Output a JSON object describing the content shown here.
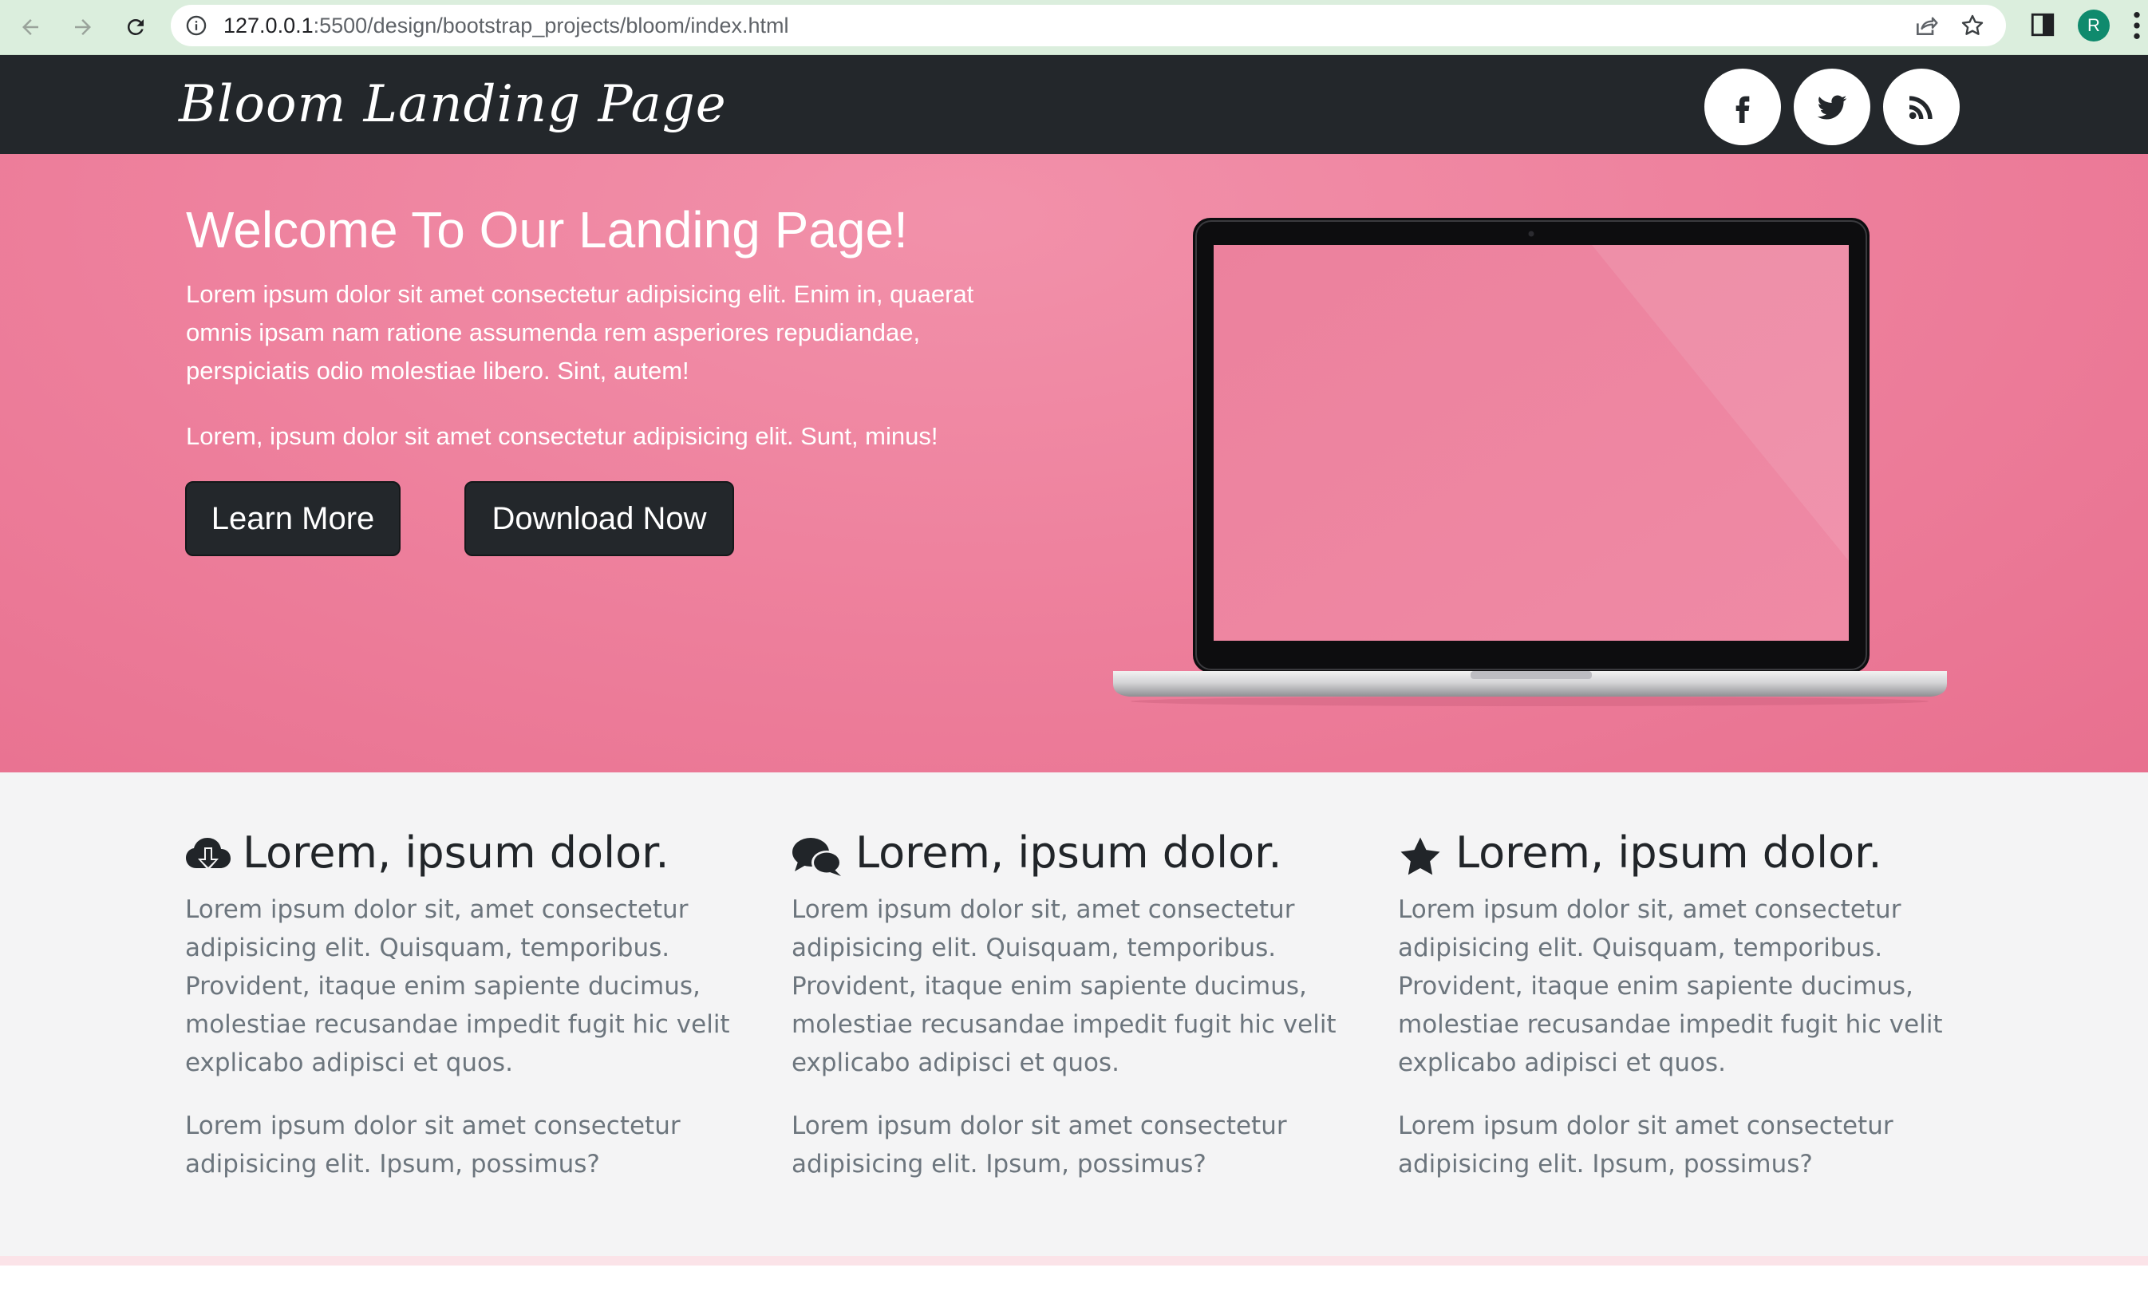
{
  "browser": {
    "url_host": "127.0.0.1",
    "url_rest": ":5500/design/bootstrap_projects/bloom/index.html",
    "profile_initial": "R",
    "icons": [
      "back-arrow-icon",
      "forward-arrow-icon",
      "reload-icon",
      "info-icon",
      "share-icon",
      "star-icon",
      "side-panel-icon",
      "more-menu-icon"
    ]
  },
  "navbar": {
    "brand": "Bloom Landing Page",
    "social": [
      "facebook-icon",
      "twitter-icon",
      "rss-icon"
    ]
  },
  "hero": {
    "title": "Welcome To Our Landing Page!",
    "paragraph1": "Lorem ipsum dolor sit amet consectetur adipisicing elit. Enim in, quaerat omnis ipsam nam ratione assumenda rem asperiores repudiandae, perspiciatis odio molestiae libero. Sint, autem!",
    "paragraph2": "Lorem, ipsum dolor sit amet consectetur adipisicing elit. Sunt, minus!",
    "learn_more": "Learn More",
    "download_now": "Download Now"
  },
  "features": [
    {
      "icon": "cloud-download-icon",
      "title": "Lorem, ipsum dolor.",
      "text1": "Lorem ipsum dolor sit, amet consectetur adipisicing elit. Quisquam, temporibus. Provident, itaque enim sapiente ducimus, molestiae recusandae impedit fugit hic velit explicabo adipisci et quos.",
      "text2": "Lorem ipsum dolor sit amet consectetur adipisicing elit. Ipsum, possimus?"
    },
    {
      "icon": "comments-icon",
      "title": "Lorem, ipsum dolor.",
      "text1": "Lorem ipsum dolor sit, amet consectetur adipisicing elit. Quisquam, temporibus. Provident, itaque enim sapiente ducimus, molestiae recusandae impedit fugit hic velit explicabo adipisci et quos.",
      "text2": "Lorem ipsum dolor sit amet consectetur adipisicing elit. Ipsum, possimus?"
    },
    {
      "icon": "star-icon",
      "title": "Lorem, ipsum dolor.",
      "text1": "Lorem ipsum dolor sit, amet consectetur adipisicing elit. Quisquam, temporibus. Provident, itaque enim sapiente ducimus, molestiae recusandae impedit fugit hic velit explicabo adipisci et quos.",
      "text2": "Lorem ipsum dolor sit amet consectetur adipisicing elit. Ipsum, possimus?"
    }
  ],
  "colors": {
    "chrome_bg": "#dbeedd",
    "navbar_bg": "#23272b",
    "hero_pink": "#ed7e9b",
    "features_bg": "#f4f4f5",
    "avatar_bg": "#0f8a6d"
  }
}
